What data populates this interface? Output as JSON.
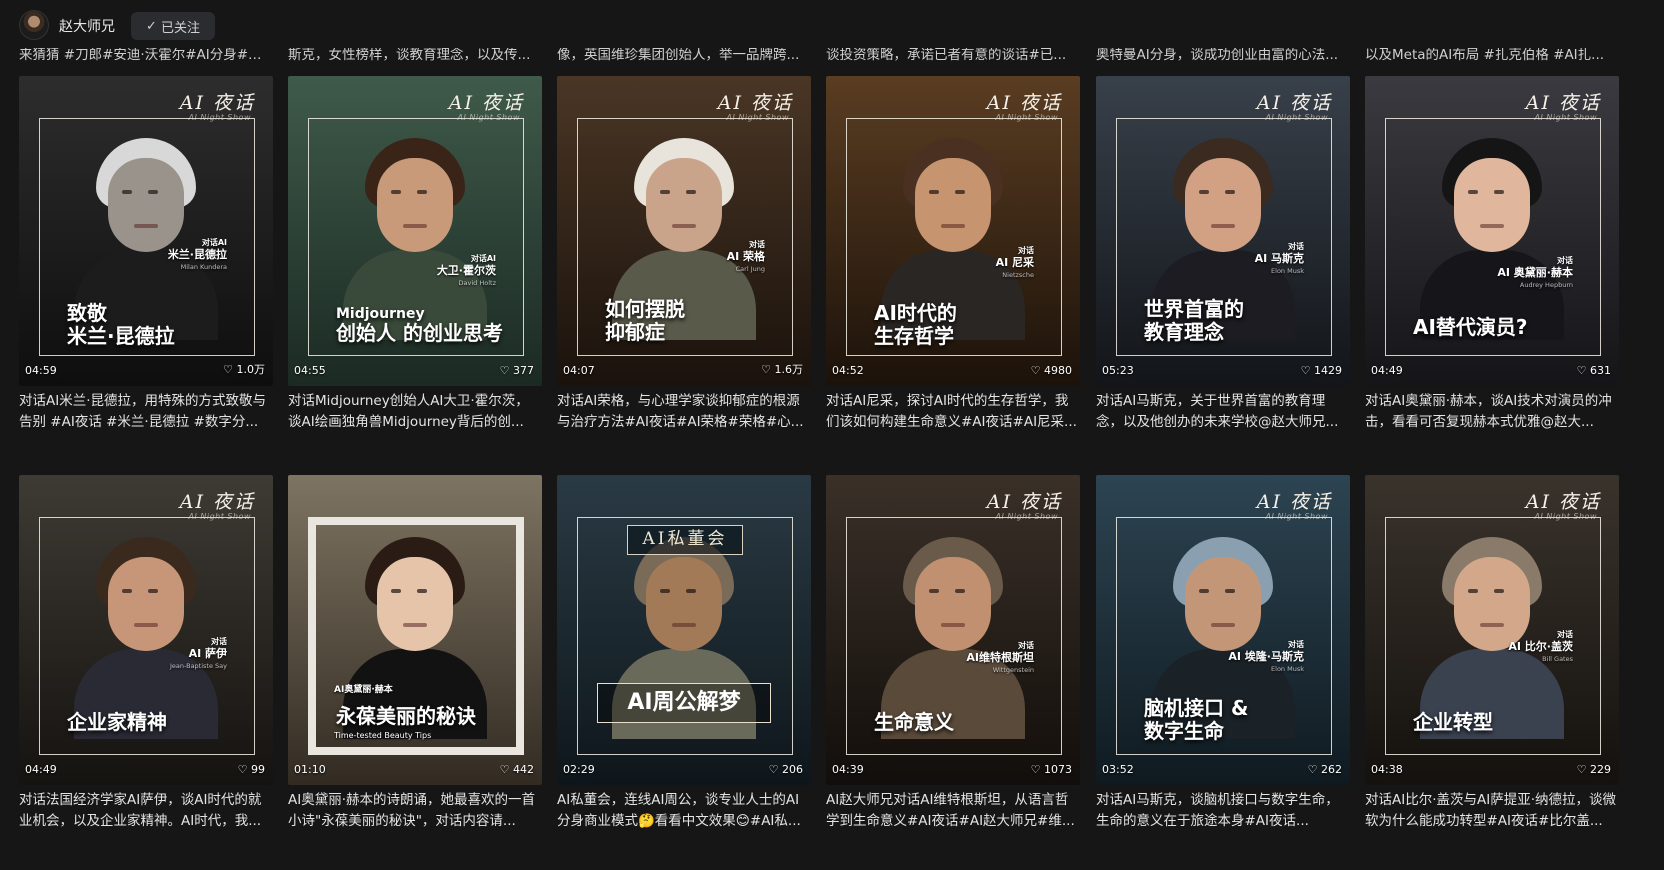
{
  "header": {
    "username": "赵大师兄",
    "follow_label": "已关注",
    "follow_icon": "check-icon"
  },
  "previous_row": [
    "来猜猜 #刀郎#安迪·沃霍尔#AI分身#罗...",
    "斯克，女性榜样，谈教育理念，以及传...",
    "像，英国维珍集团创始人，举一品牌跨...",
    "谈投资策略，承诺已者有意的谈话#已...",
    "奥特曼AI分身，谈成功创业由富的心法...",
    "以及Meta的AI布局 #扎克伯格 #AI扎..."
  ],
  "show": {
    "title": "AI 夜话",
    "subtitle": "AI Night Show"
  },
  "videos": [
    {
      "duration": "04:59",
      "likes": "1.0万",
      "tag": "对话AI",
      "guest": "米兰·昆德拉",
      "guest_en": "Milan Kundera",
      "headline": [
        "致敬",
        "米兰·昆德拉"
      ],
      "description": "对话AI米兰·昆德拉，用特殊的方式致敬与告别 #AI夜话 #米兰·昆德拉 #数字分..."
    },
    {
      "duration": "04:55",
      "likes": "377",
      "tag": "对话AI",
      "guest": "大卫·霍尔茨",
      "guest_en": "David Holtz",
      "headline": [
        "Midjourney",
        "创始人 的创业思考"
      ],
      "description": "对话Midjourney创始人AI大卫·霍尔茨，谈AI绘画独角兽Midjourney背后的创..."
    },
    {
      "duration": "04:07",
      "likes": "1.6万",
      "tag": "对话",
      "guest": "AI 荣格",
      "guest_en": "Carl Jung",
      "headline": [
        "如何摆脱",
        "抑郁症"
      ],
      "description": "对话AI荣格，与心理学家谈抑郁症的根源与治疗方法#AI夜话#AI荣格#荣格#心..."
    },
    {
      "duration": "04:52",
      "likes": "4980",
      "tag": "对话",
      "guest": "AI 尼采",
      "guest_en": "Nietzsche",
      "headline": [
        "AI时代的",
        "生存哲学"
      ],
      "description": "对话AI尼采，探讨AI时代的生存哲学，我们该如何构建生命意义#AI夜话#AI尼采..."
    },
    {
      "duration": "05:23",
      "likes": "1429",
      "tag": "对话",
      "guest": "AI 马斯克",
      "guest_en": "Elon Musk",
      "headline": [
        "世界首富的",
        "教育理念"
      ],
      "description": "对话AI马斯克，关于世界首富的教育理念，以及他创办的未来学校@赵大师兄..."
    },
    {
      "duration": "04:49",
      "likes": "631",
      "tag": "对话",
      "guest": "AI 奥黛丽·赫本",
      "guest_en": "Audrey Hepburn",
      "headline": [
        "AI替代演员?"
      ],
      "description": "对话AI奥黛丽·赫本，谈AI技术对演员的冲击，看看可否复现赫本式优雅@赵大..."
    },
    {
      "duration": "04:49",
      "likes": "99",
      "tag": "对话",
      "guest": "AI 萨伊",
      "guest_en": "Jean-Baptiste Say",
      "headline": [
        "企业家精神"
      ],
      "description": "对话法国经济学家AI萨伊，谈AI时代的就业机会，以及企业家精神。AI时代，我..."
    },
    {
      "duration": "01:10",
      "likes": "442",
      "tag": "AI奥黛丽·赫本",
      "guest": "",
      "guest_en": "Time-tested Beauty Tips",
      "headline": [
        "永葆美丽的秘诀"
      ],
      "description": "AI奥黛丽·赫本的诗朗诵，她最喜欢的一首小诗\"永葆美丽的秘诀\"，对话内容请..."
    },
    {
      "duration": "02:29",
      "likes": "206",
      "tag": "AI私董会",
      "guest": "",
      "guest_en": "",
      "headline": [
        "AI周公解梦"
      ],
      "description": "AI私董会，连线AI周公，谈专业人士的AI分身商业模式🤔看看中文效果😊#AI私..."
    },
    {
      "duration": "04:39",
      "likes": "1073",
      "tag": "对话",
      "guest": "AI维特根斯坦",
      "guest_en": "Wittgenstein",
      "headline": [
        "生命意义"
      ],
      "description": "AI赵大师兄对话AI维特根斯坦，从语言哲学到生命意义#AI夜话#AI赵大师兄#维..."
    },
    {
      "duration": "03:52",
      "likes": "262",
      "tag": "对话",
      "guest": "AI 埃隆·马斯克",
      "guest_en": "Elon Musk",
      "headline": [
        "脑机接口 &",
        "数字生命"
      ],
      "description": "对话AI马斯克，谈脑机接口与数字生命，生命的意义在于旅途本身#AI夜话..."
    },
    {
      "duration": "04:38",
      "likes": "229",
      "tag": "对话",
      "guest": "AI 比尔·盖茨",
      "guest_en": "Bill Gates",
      "headline": [
        "企业转型"
      ],
      "description": "对话AI比尔·盖茨与AI萨提亚·纳德拉，谈微软为什么能成功转型#AI夜话#比尔盖..."
    }
  ],
  "colors": {
    "background": "#161616",
    "text": "#e4e4e4",
    "follow_button_bg": "#2b2c30"
  }
}
